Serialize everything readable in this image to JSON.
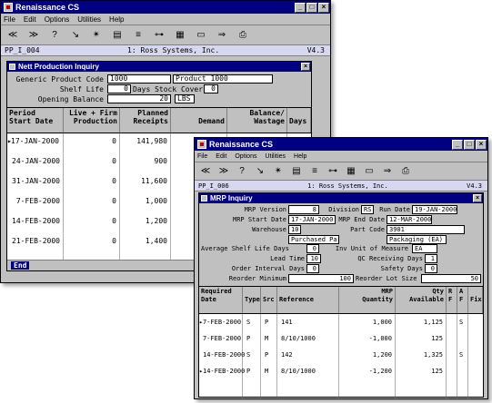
{
  "colors": {
    "titlebar": "#000080",
    "chrome": "#c0c0c0",
    "strip": "#d7d7f0"
  },
  "win1": {
    "title": "Renaissance CS",
    "menu": [
      "File",
      "Edit",
      "Options",
      "Utilities",
      "Help"
    ],
    "tools": [
      "rewind-icon",
      "fast-forward-icon",
      "help-icon",
      "pointer-icon",
      "run-icon",
      "calculator-icon",
      "list-icon",
      "tree-icon",
      "grid-icon",
      "window-icon",
      "forward-icon",
      "print-icon"
    ],
    "strip_left": "PP_I_004",
    "strip_mid": "1: Ross Systems, Inc.",
    "strip_right": "V4.3",
    "form": {
      "title": "Nett Production Inquiry",
      "generic_label": "Generic Product Code",
      "generic_value": "1000",
      "product_value": "Product 1000",
      "shelf_label": "Shelf Life",
      "shelf_value": "0",
      "cover_label": "Days Stock Cover",
      "cover_value": "0",
      "opening_label": "Opening Balance",
      "opening_value": "20",
      "opening_unit": "LBS"
    },
    "headers": [
      "Period\nStart Date",
      "Live + Firm\nProduction",
      "Planned\nReceipts",
      "Demand",
      "Balance/\nWastage",
      "Days"
    ],
    "rows": [
      {
        "date": "17-JAN-2000",
        "live": "0",
        "planned": "141,980",
        "marker": true
      },
      {
        "date": "24-JAN-2000",
        "live": "0",
        "planned": "900",
        "marker": false
      },
      {
        "date": "31-JAN-2000",
        "live": "0",
        "planned": "11,600",
        "marker": false
      },
      {
        "date": "7-FEB-2000",
        "live": "0",
        "planned": "1,000",
        "marker": false
      },
      {
        "date": "14-FEB-2000",
        "live": "0",
        "planned": "1,200",
        "marker": false
      },
      {
        "date": "21-FEB-2000",
        "live": "0",
        "planned": "1,400",
        "marker": false
      }
    ],
    "status": "End"
  },
  "win2": {
    "title": "Renaissance CS",
    "menu": [
      "File",
      "Edit",
      "Options",
      "Utilities",
      "Help"
    ],
    "tools": [
      "rewind-icon",
      "fast-forward-icon",
      "help-icon",
      "pointer-icon",
      "run-icon",
      "calculator-icon",
      "list-icon",
      "tree-icon",
      "grid-icon",
      "window-icon",
      "forward-icon",
      "print-icon"
    ],
    "strip_left": "PP_I_006",
    "strip_mid": "1: Ross Systems, Inc.",
    "strip_right": "V4.3",
    "form": {
      "title": "MRP Inquiry",
      "mrp_version_label": "MRP Version",
      "mrp_version": "8",
      "division_label": "Division",
      "division": "RS",
      "run_date_label": "Run Date",
      "run_date": "19-JAN-2000",
      "mrp_start_label": "MRP Start Date",
      "mrp_start": "17-JAN-2000",
      "mrp_end_label": "MRP End Date",
      "mrp_end": "12-MAR-2000",
      "warehouse_label": "Warehouse",
      "warehouse": "10",
      "warehouse_desc": "Purchased Part",
      "part_code_label": "Part Code",
      "part_code": "3901",
      "part_desc": "Packaging (EA)",
      "avg_shelf_label": "Average Shelf Life Days",
      "avg_shelf": "0",
      "inv_uom_label": "Inv Unit of Measure",
      "inv_uom": "EA",
      "lead_time_label": "Lead Time",
      "lead_time": "10",
      "qc_days_label": "QC Receiving Days",
      "qc_days": "1",
      "order_interval_label": "Order Interval Days",
      "order_interval": "0",
      "safety_days_label": "Safety Days",
      "safety_days": "0",
      "reorder_min_label": "Reorder Minimum",
      "reorder_min": "100",
      "reorder_lot_label": "Reorder Lot Size",
      "reorder_lot": "50"
    },
    "headers": {
      "date": "Required\nDate",
      "type": "Type",
      "src": "Src",
      "ref": "Reference",
      "qty": "MRP\nQuantity",
      "avail": "Qty\nAvailable",
      "r": "R\nF",
      "a": "A\nF",
      "fix": "\nFix"
    },
    "rows": [
      {
        "date": "7-FEB-2000",
        "type": "S",
        "src": "P",
        "ref": "141",
        "qty": "1,000",
        "avail": "1,125",
        "flag": "S",
        "marker": true
      },
      {
        "date": "7-FEB-2000",
        "type": "P",
        "src": "M",
        "ref": "8/10/1000",
        "qty": "-1,000",
        "avail": "125",
        "flag": "",
        "marker": false
      },
      {
        "date": "14-FEB-2000",
        "type": "S",
        "src": "P",
        "ref": "142",
        "qty": "1,200",
        "avail": "1,325",
        "flag": "S",
        "marker": false
      },
      {
        "date": "14-FEB-2000",
        "type": "P",
        "src": "M",
        "ref": "8/10/1000",
        "qty": "-1,200",
        "avail": "125",
        "flag": "",
        "marker": true
      }
    ]
  }
}
